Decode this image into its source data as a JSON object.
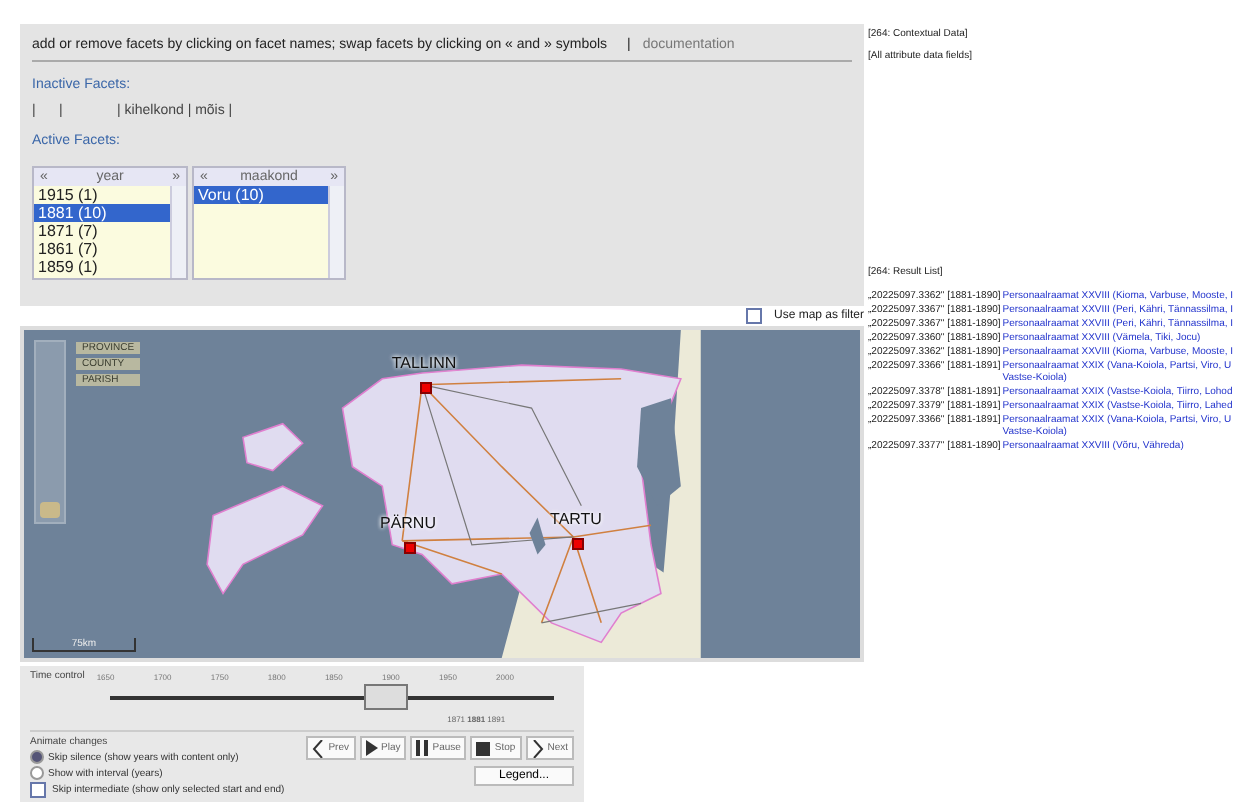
{
  "instructions": {
    "text": "add or remove facets by clicking on facet names; swap facets by clicking on « and » symbols",
    "separator": "|",
    "link": "documentation"
  },
  "inactive_facets": {
    "label": "Inactive Facets:",
    "line": "|      |              | kihelkond | mõis |"
  },
  "active_facets": {
    "label": "Active Facets:",
    "facets": [
      {
        "swap_left": "«",
        "name": "year",
        "swap_right": "»",
        "items": [
          {
            "label": "1915 (1)",
            "selected": false
          },
          {
            "label": "1881 (10)",
            "selected": true
          },
          {
            "label": "1871 (7)",
            "selected": false
          },
          {
            "label": "1861 (7)",
            "selected": false
          },
          {
            "label": "1859 (1)",
            "selected": false
          }
        ]
      },
      {
        "swap_left": "«",
        "name": "maakond",
        "swap_right": "»",
        "items": [
          {
            "label": "Voru (10)",
            "selected": true
          }
        ]
      }
    ]
  },
  "contextual": {
    "title": "[264: Contextual Data]",
    "fields": "[All attribute data fields]"
  },
  "map_filter": {
    "label": "Use map as filter",
    "checked": false
  },
  "map": {
    "zoom": {
      "level": 0
    },
    "zoom_labels": [
      "PROVINCE",
      "COUNTY",
      "PARISH"
    ],
    "cities": [
      {
        "name": "TALLINN"
      },
      {
        "name": "PÄRNU"
      },
      {
        "name": "TARTU"
      }
    ],
    "scale": "75km"
  },
  "results": {
    "title": "[264: Result List]",
    "rows": [
      {
        "id": "„20225097.3362\"",
        "years": "[1881-1890]",
        "link": "Personaalraamat XXVIII (Kioma, Varbuse, Mooste, I"
      },
      {
        "id": "„20225097.3367\"",
        "years": "[1881-1890]",
        "link": "Personaalraamat XXVIII (Peri, Kähri, Tännassilma, I"
      },
      {
        "id": "„20225097.3367\"",
        "years": "[1881-1890]",
        "link": "Personaalraamat XXVIII (Peri, Kähri, Tännassilma, I"
      },
      {
        "id": "„20225097.3360\"",
        "years": "[1881-1890]",
        "link": "Personaalraamat XXVIII (Vämela, Tiki, Jocu)"
      },
      {
        "id": "„20225097.3362\"",
        "years": "[1881-1890]",
        "link": "Personaalraamat XXVIII (Kioma, Varbuse, Mooste, I"
      },
      {
        "id": "„20225097.3366\"",
        "years": "[1881-1891]",
        "link": "Personaalraamat XXIX (Vana-Koiola, Partsi, Viro, U Vastse-Koiola)"
      },
      {
        "id": "„20225097.3378\"",
        "years": "[1881-1891]",
        "link": "Personaalraamat XXIX (Vastse-Koiola, Tiirro, Lohod"
      },
      {
        "id": "„20225097.3379\"",
        "years": "[1881-1891]",
        "link": "Personaalraamat XXIX (Vastse-Koiola, Tiirro, Lahed"
      },
      {
        "id": "„20225097.3366\"",
        "years": "[1881-1891]",
        "link": "Personaalraamat XXIX (Vana-Koiola, Partsi, Viro, U Vastse-Koiola)"
      },
      {
        "id": "„20225097.3377\"",
        "years": "[1881-1890]",
        "link": "Personaalraamat XXVIII (Võru, Vähreda)"
      }
    ]
  },
  "time_control": {
    "label": "Time control",
    "ticks": [
      "1650",
      "1700",
      "1750",
      "1800",
      "1850",
      "1900",
      "1950",
      "2000"
    ],
    "window": {
      "start": "1871",
      "current": "1881",
      "end": "1891"
    },
    "level": 0.62
  },
  "animate": {
    "label": "Animate changes",
    "options": [
      {
        "kind": "radio",
        "label": "Skip silence (show years with content only)",
        "selected": true
      },
      {
        "kind": "radio",
        "label": "Show with interval (years)",
        "selected": false
      },
      {
        "kind": "checkbox",
        "label": "Skip intermediate (show only selected start and end)",
        "selected": false
      }
    ],
    "buttons": [
      {
        "kind": "prev",
        "label": "Prev"
      },
      {
        "kind": "play",
        "label": "Play"
      },
      {
        "kind": "pause",
        "label": "Pause"
      },
      {
        "kind": "stop",
        "label": "Stop"
      },
      {
        "kind": "next",
        "label": "Next"
      }
    ],
    "legend": "Legend..."
  }
}
